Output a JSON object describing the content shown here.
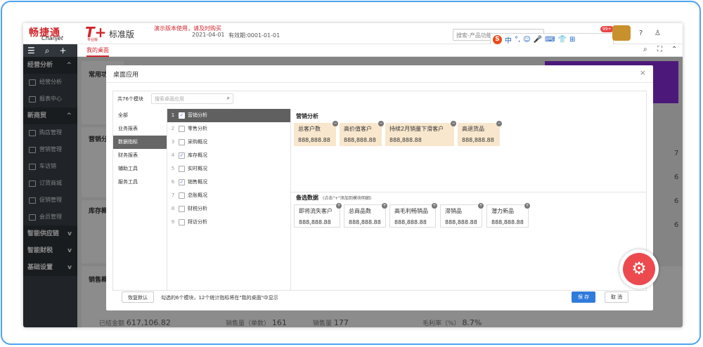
{
  "brand": {
    "name_cn": "畅捷通",
    "name_en": "Chanjet",
    "tplus": "T+",
    "tplus_sub": "专业版",
    "edition": "标准版",
    "demo_note": "演示版本使用，请及时购买",
    "date": "2021-04-01",
    "valid": "有效期:0001-01-01"
  },
  "top": {
    "search_placeholder": "搜索-产品功能",
    "notif_badge": "99+",
    "ime": [
      "中",
      "°,",
      "☺",
      "🎤",
      "⌨",
      "👕",
      "⊞"
    ]
  },
  "subbar": {
    "tab": "我的桌面"
  },
  "sidebar": {
    "groups": [
      {
        "label": "经营分析",
        "items": [
          "经营分析",
          "报表中心"
        ]
      },
      {
        "label": "新商贸",
        "items": [
          "购店管理",
          "营销管理",
          "车访销",
          "订货商城",
          "促销管理",
          "会员管理"
        ]
      },
      {
        "label": "智能供应链",
        "items": []
      },
      {
        "label": "智能财税",
        "items": []
      },
      {
        "label": "基础设置",
        "items": []
      }
    ]
  },
  "background": {
    "sections": [
      "常用功",
      "营销分",
      "库存概",
      "销售概"
    ],
    "bottom": [
      {
        "label": "已结金额",
        "value": "617,106.82"
      },
      {
        "label": "销售量（单数）",
        "value": "161"
      },
      {
        "label": "销售量",
        "value": "177"
      },
      {
        "label": "毛利率（%）",
        "value": "8.7%"
      }
    ],
    "right_nums": [
      "7",
      "6",
      "6",
      "6"
    ]
  },
  "modal": {
    "title": "桌面应用",
    "count": "共76个模块",
    "search_placeholder": "搜索桌面应用",
    "categories": [
      "全部",
      "业务报表",
      "数据指标",
      "财务报表",
      "辅助工具",
      "服务工具"
    ],
    "active_category": "数据指标",
    "modules": [
      {
        "n": "1",
        "label": "营销分析",
        "checked": true
      },
      {
        "n": "2",
        "label": "零售分析",
        "checked": false
      },
      {
        "n": "3",
        "label": "采购概况",
        "checked": false
      },
      {
        "n": "4",
        "label": "库存概况",
        "checked": true
      },
      {
        "n": "5",
        "label": "实时概况",
        "checked": false
      },
      {
        "n": "6",
        "label": "销售概况",
        "checked": true
      },
      {
        "n": "7",
        "label": "总账概况",
        "checked": false
      },
      {
        "n": "8",
        "label": "财税分析",
        "checked": false
      },
      {
        "n": "9",
        "label": "拜访分析",
        "checked": false
      }
    ],
    "selected_title": "营销分析",
    "selected": [
      {
        "label": "总客户数",
        "value": "888,888.88"
      },
      {
        "label": "高价值客户",
        "value": "888,888.88"
      },
      {
        "label": "持续2月销量下滑客户",
        "value": "888,888.88"
      },
      {
        "label": "高退货品",
        "value": "888,888.88"
      }
    ],
    "candidate_title": "备选数据",
    "candidate_note": "(点击\"+\"添加到模块明细)",
    "candidates": [
      {
        "label": "即将流失客户",
        "value": "888,888.88"
      },
      {
        "label": "总商品数",
        "value": "888,888.88"
      },
      {
        "label": "高毛利畅销品",
        "value": "888,888.88"
      },
      {
        "label": "滞销品",
        "value": "888,888.88"
      },
      {
        "label": "潜力新品",
        "value": "888,888.88"
      }
    ],
    "restore": "恢复默认",
    "footer_text": "勾选的6个模块，12个统计指标将在\"我的桌面\"中显示",
    "save": "保 存",
    "cancel": "取 消"
  },
  "colors": {
    "brand_red": "#d0262b",
    "save_blue": "#2f7bdc",
    "gear_red": "#ec4a4e",
    "frame_blue": "#4da3f0"
  }
}
